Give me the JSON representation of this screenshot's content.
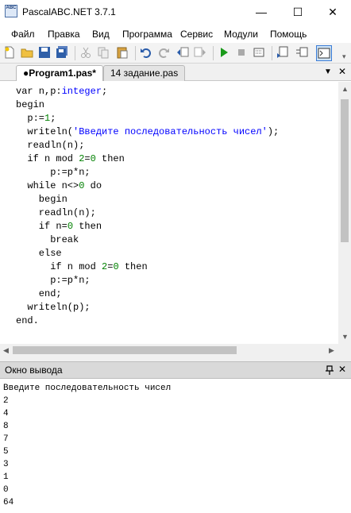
{
  "window": {
    "title": "PascalABC.NET 3.7.1",
    "app_icon_text": "ABC",
    "controls": {
      "minimize": "—",
      "maximize": "☐",
      "close": "✕"
    }
  },
  "menu": [
    "Файл",
    "Правка",
    "Вид",
    "Программа",
    "Сервис",
    "Модули",
    "Помощь"
  ],
  "toolbar": {
    "buttons": [
      "new-file-icon",
      "open-folder-icon",
      "save-icon",
      "save-all-icon",
      "cut-icon",
      "copy-icon",
      "paste-icon",
      "undo-icon",
      "redo-icon",
      "navigate-back-icon",
      "navigate-forward-icon",
      "run-icon",
      "stop-icon",
      "debug-icon",
      "compile-icon",
      "step-icon",
      "console-icon"
    ]
  },
  "tabs": [
    {
      "label": "●Program1.pas*",
      "active": true
    },
    {
      "label": "14 задание.pas",
      "active": false
    }
  ],
  "editor": {
    "lines": [
      [
        {
          "t": "var n,p:",
          "c": "kw"
        },
        {
          "t": "integer",
          "c": "typ"
        },
        {
          "t": ";",
          "c": "kw"
        }
      ],
      [
        {
          "t": "begin",
          "c": "kw"
        }
      ],
      [
        {
          "t": "  p:=",
          "c": "kw"
        },
        {
          "t": "1",
          "c": "num"
        },
        {
          "t": ";",
          "c": "kw"
        }
      ],
      [
        {
          "t": "  writeln(",
          "c": "kw"
        },
        {
          "t": "'Введите последовательность чисел'",
          "c": "str"
        },
        {
          "t": ");",
          "c": "kw"
        }
      ],
      [
        {
          "t": "  readln(n);",
          "c": "kw"
        }
      ],
      [
        {
          "t": "  if n mod ",
          "c": "kw"
        },
        {
          "t": "2",
          "c": "num"
        },
        {
          "t": "=",
          "c": "kw"
        },
        {
          "t": "0",
          "c": "num"
        },
        {
          "t": " then",
          "c": "kw"
        }
      ],
      [
        {
          "t": "      p:=p*n;",
          "c": "kw"
        }
      ],
      [
        {
          "t": "  while n<>",
          "c": "kw"
        },
        {
          "t": "0",
          "c": "num"
        },
        {
          "t": " do",
          "c": "kw"
        }
      ],
      [
        {
          "t": "    begin",
          "c": "kw"
        }
      ],
      [
        {
          "t": "    readln(n);",
          "c": "kw"
        }
      ],
      [
        {
          "t": "    if n=",
          "c": "kw"
        },
        {
          "t": "0",
          "c": "num"
        },
        {
          "t": " then",
          "c": "kw"
        }
      ],
      [
        {
          "t": "      break",
          "c": "kw"
        }
      ],
      [
        {
          "t": "    else",
          "c": "kw"
        }
      ],
      [
        {
          "t": "      if n mod ",
          "c": "kw"
        },
        {
          "t": "2",
          "c": "num"
        },
        {
          "t": "=",
          "c": "kw"
        },
        {
          "t": "0",
          "c": "num"
        },
        {
          "t": " then",
          "c": "kw"
        }
      ],
      [
        {
          "t": "      p:=p*n;",
          "c": "kw"
        }
      ],
      [
        {
          "t": "    end;",
          "c": "kw"
        }
      ],
      [
        {
          "t": "  writeln(p);",
          "c": "kw"
        }
      ],
      [
        {
          "t": "end.",
          "c": "kw"
        }
      ]
    ]
  },
  "output_panel": {
    "title": "Окно вывода",
    "pin": "ᴛ",
    "close": "✕",
    "lines": [
      "Введите последовательность чисел",
      "2",
      "4",
      "8",
      "7",
      "5",
      "3",
      "1",
      "0",
      "64"
    ]
  },
  "colors": {
    "keyword": "#000000",
    "number": "#008000",
    "string": "#0000ff",
    "type": "#0000ff"
  }
}
